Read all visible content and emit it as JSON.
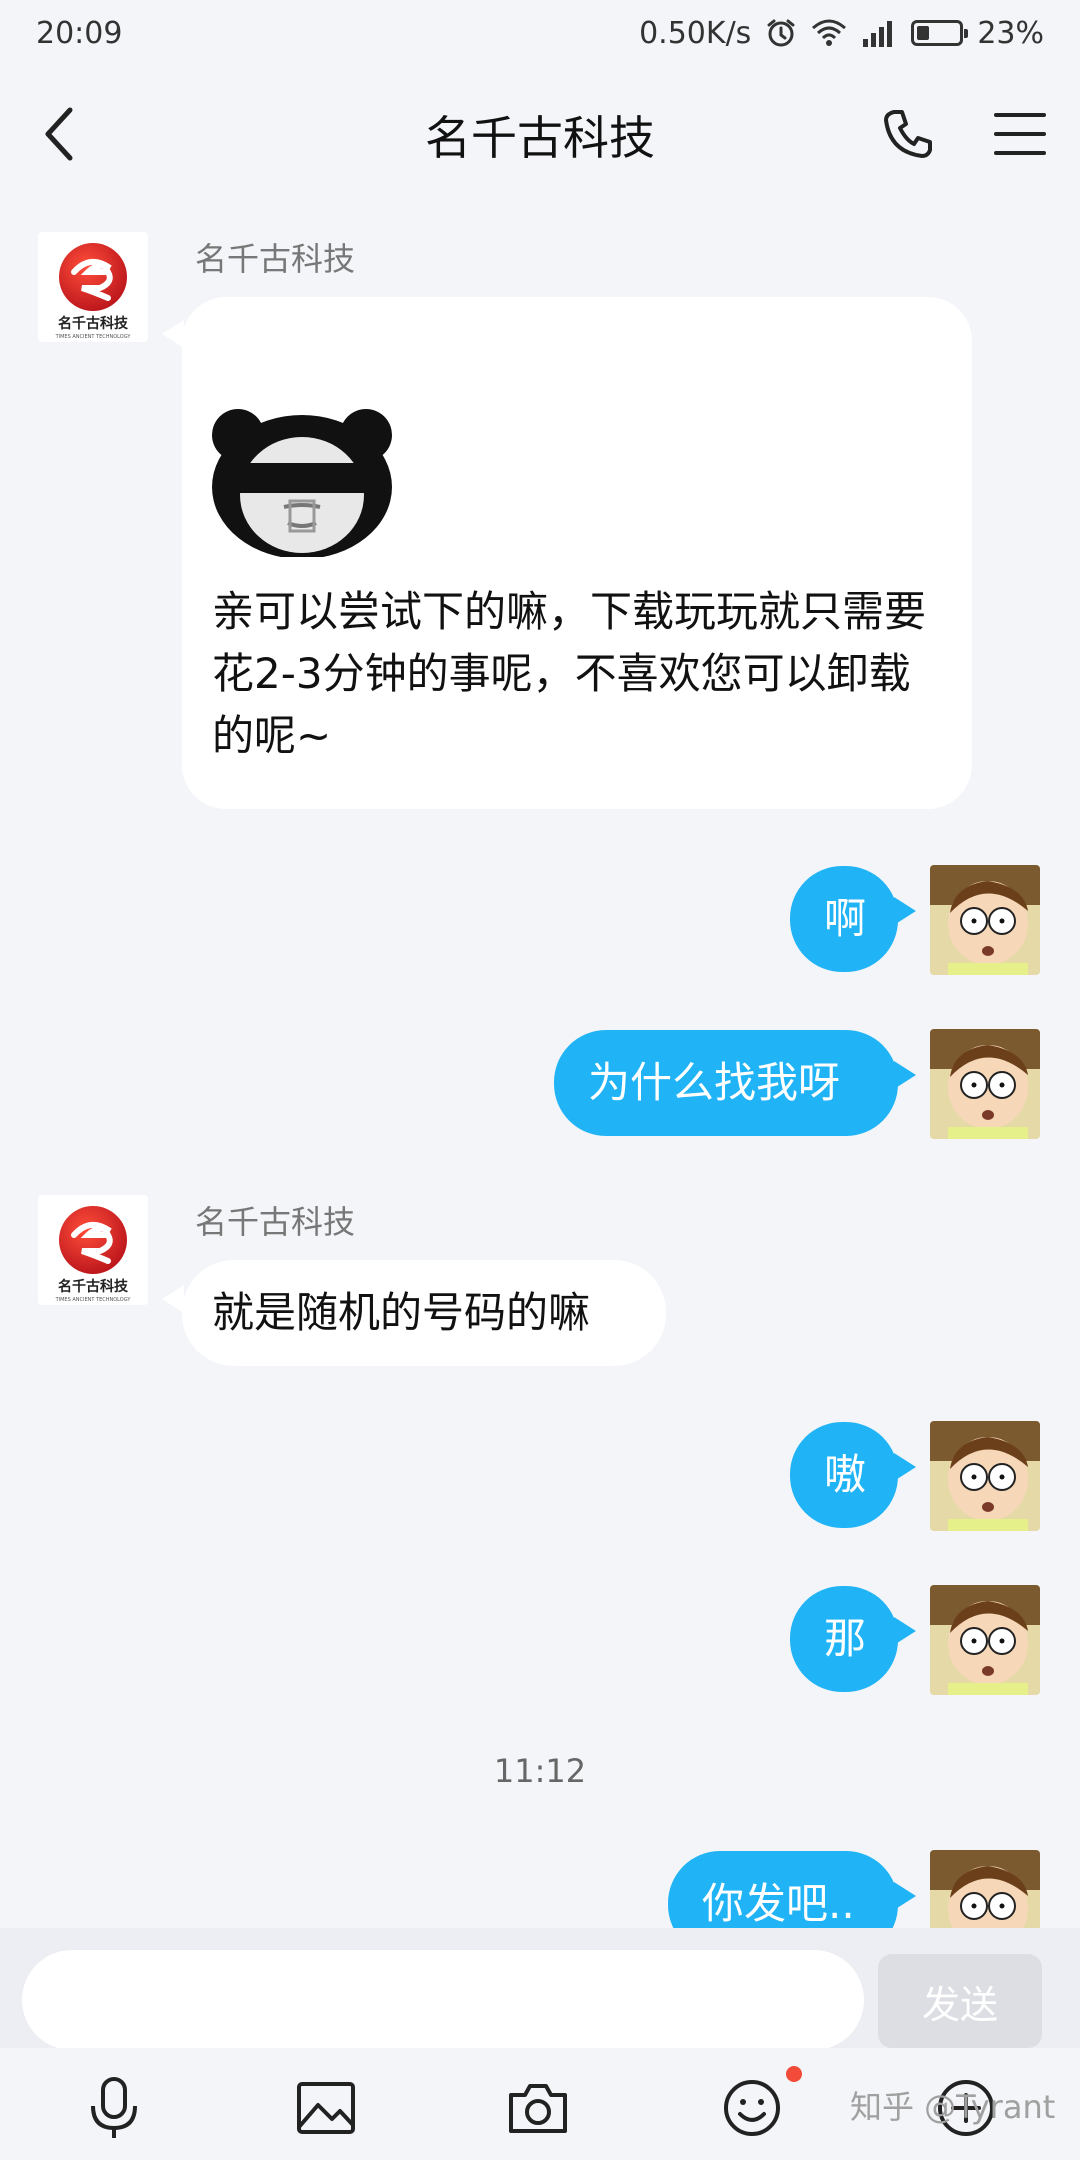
{
  "status_bar": {
    "time": "20:09",
    "net_speed": "0.50K/s",
    "battery": "23%",
    "icons": [
      "alarm-icon",
      "wifi-icon",
      "signal-icon",
      "battery-icon"
    ]
  },
  "header": {
    "title": "名千古科技",
    "icons": [
      "back-icon",
      "phone-icon",
      "menu-icon"
    ]
  },
  "brand": {
    "logo_text": "名千古科技",
    "logo_subtext": "TIMES ANCIENT TECHNOLOGY"
  },
  "messages": [
    {
      "from": "contact",
      "sender": "名千古科技",
      "has_sticker": true,
      "sticker": "panda-meme",
      "text": "亲可以尝试下的嘛，下载玩玩就只需要花2-3分钟的事呢，不喜欢您可以卸载的呢~"
    },
    {
      "from": "me",
      "text": "啊"
    },
    {
      "from": "me",
      "text": "为什么找我呀"
    },
    {
      "from": "contact",
      "sender": "名千古科技",
      "text": "就是随机的号码的嘛"
    },
    {
      "from": "me",
      "text": "嗷"
    },
    {
      "from": "me",
      "text": "那"
    },
    {
      "type": "timestamp",
      "text": "11:12"
    },
    {
      "from": "me",
      "text": "你发吧.."
    }
  ],
  "input": {
    "placeholder": "",
    "value": "",
    "send_label": "发送"
  },
  "toolbar": {
    "icons": [
      "microphone-icon",
      "image-icon",
      "camera-icon",
      "emoji-icon",
      "add-icon"
    ],
    "emoji_has_badge": true
  },
  "watermark": "知乎 @Tyrant",
  "colors": {
    "out_bubble": "#20b4f7",
    "in_bubble": "#ffffff",
    "background": "#f3f5f9",
    "badge": "#f24b3a"
  }
}
